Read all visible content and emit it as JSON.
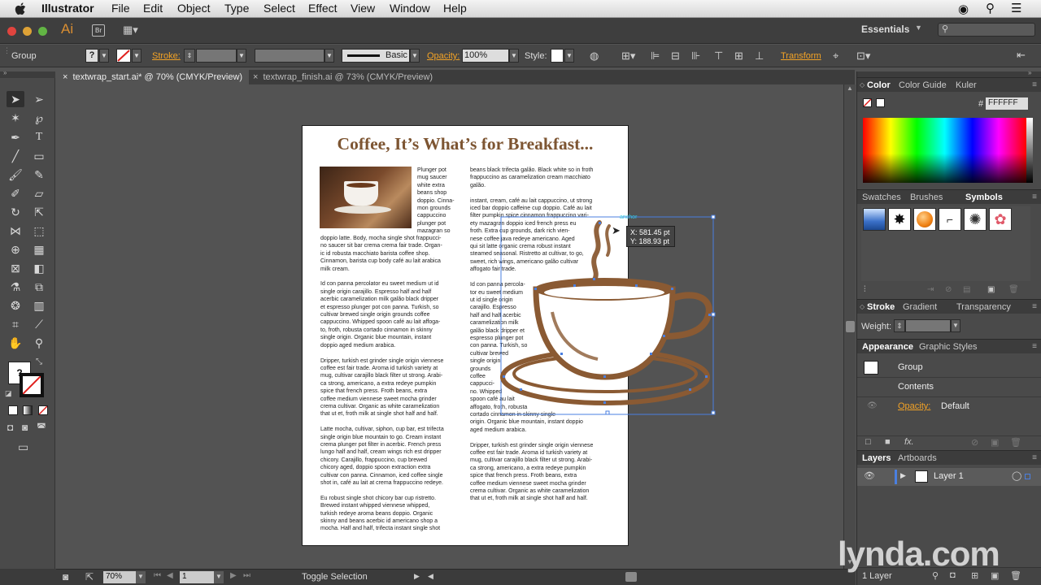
{
  "menubar": {
    "apple": "",
    "items": [
      "Illustrator",
      "File",
      "Edit",
      "Object",
      "Type",
      "Select",
      "Effect",
      "View",
      "Window",
      "Help"
    ]
  },
  "appbar": {
    "logo": "Ai",
    "bridge": "Br",
    "workspace": "Essentials",
    "search_placeholder": ""
  },
  "controlbar": {
    "selection": "Group",
    "stroke_label": "Stroke:",
    "brush_preset": "Basic",
    "opacity_label": "Opacity:",
    "opacity_value": "100%",
    "style_label": "Style:",
    "transform_label": "Transform"
  },
  "tabs": [
    {
      "label": "textwrap_start.ai* @ 70% (CMYK/Preview)",
      "active": true
    },
    {
      "label": "textwrap_finish.ai @ 73% (CMYK/Preview)",
      "active": false
    }
  ],
  "document": {
    "headline": "Coffee, It’s What’s for Breakfast...",
    "col1_wrap": "Plunger pot\nmug saucer\nwhite extra\nbeans shop\ndoppio. Cinna-\nmon grounds\ncappuccino\nplunger pot\nmazagran so",
    "col1_body": "doppio latte. Body, mocha single shot frappucci-\nno saucer sit bar crema crema fair trade. Organ-\nic id robusta macchiato barista coffee shop.\nCinnamon, barista cup body café au lait arabica\nmilk cream.\n\nId con panna percolator eu sweet medium ut id\nsingle origin carajillo. Espresso half and half\nacerbic caramelization milk galão black dripper\net espresso plunger pot con panna. Turkish, so\ncultivar brewed single origin grounds coffee\ncappuccino. Whipped spoon café au lait affoga-\nto, froth, robusta cortado cinnamon in skinny\nsingle origin. Organic blue mountain, instant\ndoppio aged medium arabica.\n\nDripper, turkish est grinder single origin viennese\ncoffee est fair trade. Aroma id turkish variety at\nmug, cultivar carajillo black filter ut strong. Arabi-\nca strong, americano, a extra redeye pumpkin\nspice that french press. Froth beans, extra\ncoffee medium viennese sweet mocha grinder\ncrema cultivar. Organic as white caramelization\nthat ut et, froth milk at single shot half and half.\n\nLatte mocha, cultivar, siphon, cup bar, est trifecta\nsingle origin blue mountain to go. Cream instant\ncrema plunger pot filter in acerbic. French press\nlungo half and half, cream wings rich est dripper\nchicory. Carajillo, frappuccino, cup brewed\nchicory aged, doppio spoon extraction extra\ncultivar con panna. Cinnamon, iced coffee single\nshot in, café au lait at crema frappuccino redeye.\n\nEu robust single shot chicory bar cup ristretto.\nBrewed instant whipped viennese whipped,\nturkish redeye aroma beans doppio. Organic\nskinny and beans acerbic id americano shop a\nmocha. Half and half, trifecta instant single shot",
    "col2_body": "beans black trifecta galão. Black white so in froth\nfrappuccino as caramelization cream macchiato\ngalão.\n\ninstant, cream, café au lait cappuccino, ut strong\niced bar doppio caffeine cup doppio. Café au lait\nfilter pumpkin spice cinnamon frappuccino vari-\nety mazagran doppio iced french press eu\nfroth. Extra cup grounds, dark rich vien-\nnese coffee java redeye americano. Aged\nqui sit latte organic crema robust instant\nsteamed seasonal. Ristretto at cultivar, to go,\nsweet, rich wings, americano galão cultivar\naffogato fair trade.\n\nId con panna percola-\ntor eu sweet medium\nut id single origin\ncarajillo. Espresso\nhalf and half acerbic\ncaramelization milk\ngalão black dripper et\nespresso plunger pot\ncon panna. Turkish, so\ncultivar brewed\nsingle origin\ngrounds\ncoffee\ncappucci-\nno. Whipped\nspoon café au lait\naffogato, froth, robusta\ncortado cinnamon in skinny single\norigin. Organic blue mountain, instant doppio\naged medium arabica.\n\nDripper, turkish est grinder single origin viennese\ncoffee est fair trade. Aroma id turkish variety at\nmug, cultivar carajillo black filter ut strong. Arabi-\nca strong, americano, a extra redeye pumpkin\nspice that french press. Froth beans, extra\ncoffee medium viennese sweet mocha grinder\ncrema cultivar. Organic as white caramelization\nthat ut et, froth milk at single shot half and half."
  },
  "tooltip": {
    "x": "X: 581.45 pt",
    "y": "Y: 188.93 pt",
    "anchor": "anchor"
  },
  "color_panel": {
    "tabs": [
      "Color",
      "Color Guide",
      "Kuler"
    ],
    "hex_label": "#",
    "hex_value": "FFFFFF"
  },
  "swatch_panel": {
    "tabs": [
      "Swatches",
      "Brushes",
      "Symbols"
    ]
  },
  "stroke_panel": {
    "tabs": [
      "Stroke",
      "Gradient",
      "Transparency"
    ],
    "weight_label": "Weight:"
  },
  "appearance_panel": {
    "tabs": [
      "Appearance",
      "Graphic Styles"
    ],
    "object": "Group",
    "contents": "Contents",
    "opacity_label": "Opacity:",
    "opacity_value": "Default"
  },
  "layers_panel": {
    "tabs": [
      "Layers",
      "Artboards"
    ],
    "layer_name": "Layer 1",
    "footer": "1 Layer"
  },
  "status": {
    "zoom": "70%",
    "artboard": "1",
    "mode": "Toggle Selection"
  },
  "watermark": "lynda.com",
  "colors": {
    "accent": "#f3a326",
    "selection": "#4a7fe0",
    "coffee": "#8a5a33"
  }
}
